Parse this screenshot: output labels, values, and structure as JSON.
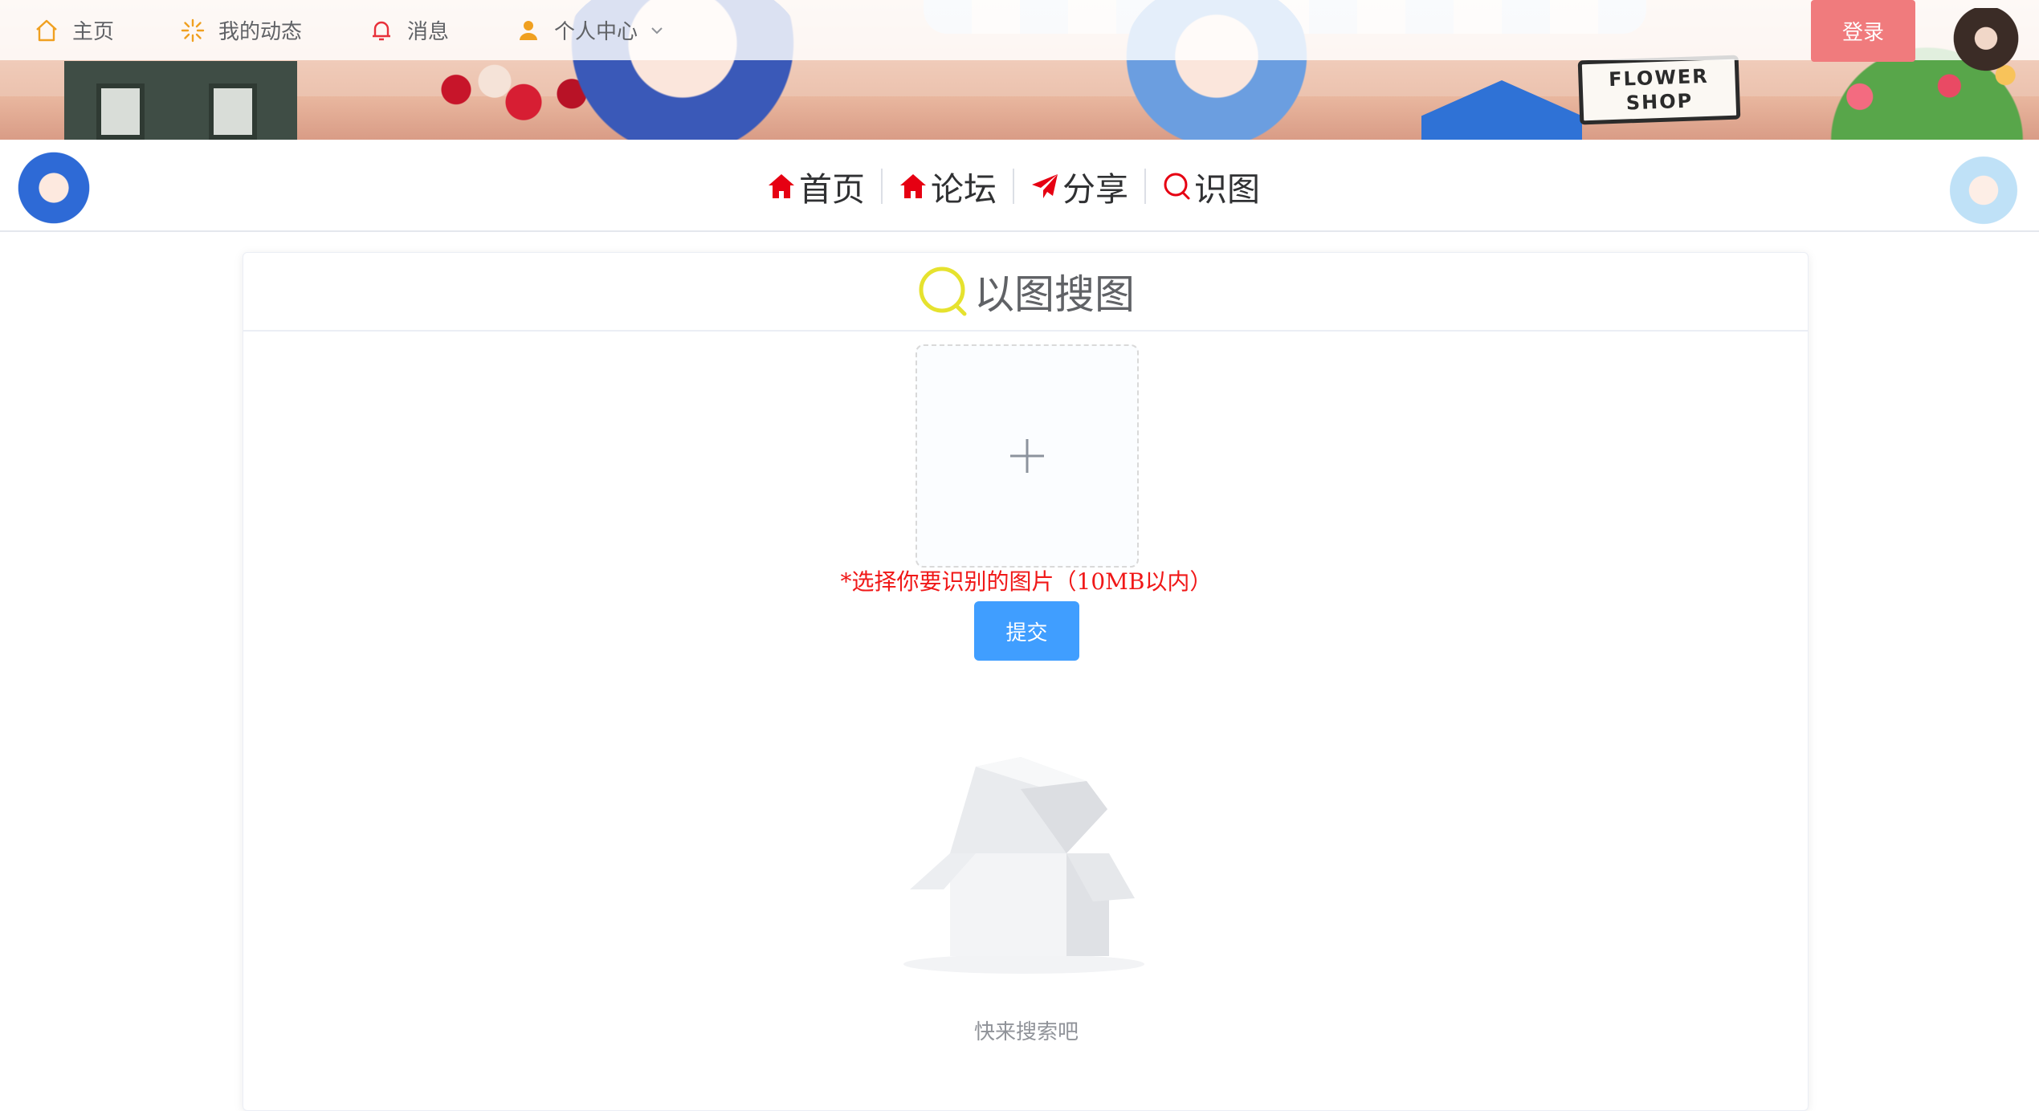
{
  "topnav": {
    "items": [
      {
        "label": "主页",
        "icon": "home-outline-icon"
      },
      {
        "label": "我的动态",
        "icon": "sunburst-icon"
      },
      {
        "label": "消息",
        "icon": "bell-icon"
      },
      {
        "label": "个人中心",
        "icon": "user-icon"
      }
    ],
    "login_label": "登录"
  },
  "banner": {
    "sign_line1": "FLOWER",
    "sign_line2": "SHOP"
  },
  "subnav": {
    "links": [
      {
        "label": "首页",
        "icon": "home-icon"
      },
      {
        "label": "论坛",
        "icon": "home-icon"
      },
      {
        "label": "分享",
        "icon": "paper-plane-icon"
      },
      {
        "label": "识图",
        "icon": "search-icon"
      }
    ],
    "accent_color": "#e60012"
  },
  "search_card": {
    "title": "以图搜图",
    "upload_icon": "plus-icon",
    "hint": "*选择你要识别的图片（10MB以内）",
    "submit_label": "提交",
    "empty_text": "快来搜索吧"
  },
  "colors": {
    "login_button": "#f07b7d",
    "submit_button": "#409eff",
    "hint_text": "#f01818",
    "title_icon": "#e6e22e"
  }
}
